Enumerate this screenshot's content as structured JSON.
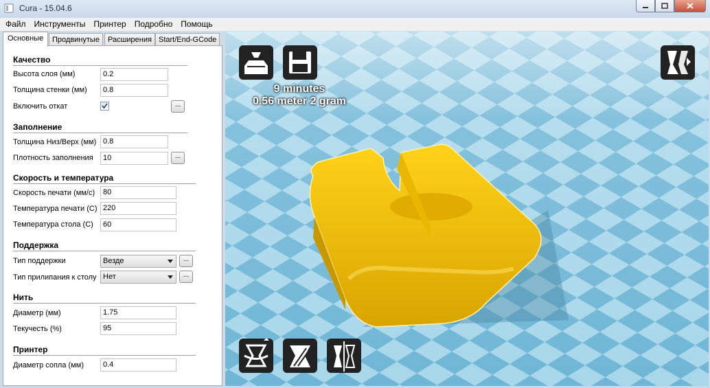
{
  "window": {
    "title": "Cura - 15.04.6"
  },
  "menu": [
    "Файл",
    "Инструменты",
    "Принтер",
    "Подробно",
    "Помощь"
  ],
  "tabs": [
    "Основные",
    "Продвинутые",
    "Расширения",
    "Start/End-GCode"
  ],
  "sections": {
    "quality": {
      "title": "Качество",
      "layer_height_label": "Высота слоя (мм)",
      "layer_height": "0.2",
      "shell_label": "Толщина стенки (мм)",
      "shell": "0.8",
      "retraction_label": "Включить откат",
      "retraction_checked": true
    },
    "fill": {
      "title": "Заполнение",
      "bottom_top_label": "Толщина Низ/Верх (мм)",
      "bottom_top": "0.8",
      "density_label": "Плотность заполнения",
      "density": "10"
    },
    "speed": {
      "title": "Скорость и температура",
      "print_speed_label": "Скорость печати (мм/с)",
      "print_speed": "80",
      "print_temp_label": "Температура печати (С)",
      "print_temp": "220",
      "bed_temp_label": "Температура стола (С)",
      "bed_temp": "60"
    },
    "support": {
      "title": "Поддержка",
      "type_label": "Тип поддержки",
      "type": "Везде",
      "adhesion_label": "Тип прилипания к столу",
      "adhesion": "Нет"
    },
    "filament": {
      "title": "Нить",
      "diameter_label": "Диаметр (мм)",
      "diameter": "1.75",
      "flow_label": "Текучесть (%)",
      "flow": "95"
    },
    "machine": {
      "title": "Принтер",
      "nozzle_label": "Диаметр сопла (мм)",
      "nozzle": "0.4"
    }
  },
  "more_button_label": "...",
  "viewport": {
    "print_time": "9 minutes",
    "material": "0.56 meter 2 gram",
    "model_color": "#f5c400",
    "grid_light": "#a8d7ea",
    "grid_dark": "#6fb6d6",
    "icons": [
      "load-icon",
      "save-icon",
      "view-mode-icon",
      "rotate-icon",
      "scale-icon",
      "mirror-icon"
    ]
  }
}
